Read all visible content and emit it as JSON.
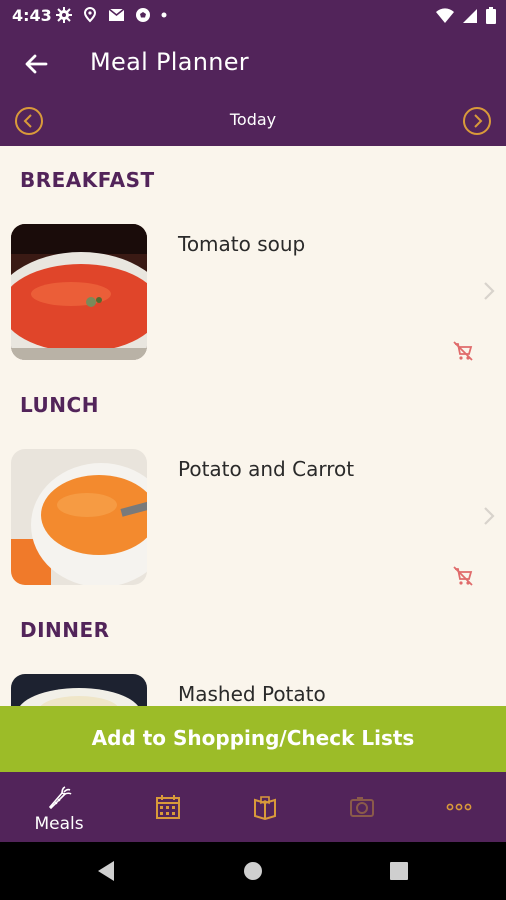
{
  "status_bar": {
    "time": "4:43"
  },
  "app_bar": {
    "title": "Meal Planner"
  },
  "date_bar": {
    "label": "Today"
  },
  "sections": [
    {
      "title": "BREAKFAST",
      "meal": "Tomato soup"
    },
    {
      "title": "LUNCH",
      "meal": "Potato and Carrot"
    },
    {
      "title": "DINNER",
      "meal": "Mashed Potato"
    }
  ],
  "action_button": {
    "label": "Add to Shopping/Check Lists"
  },
  "bottom_nav": [
    {
      "label": "Meals",
      "icon": "carrot-icon"
    },
    {
      "label": "",
      "icon": "calendar-icon"
    },
    {
      "label": "",
      "icon": "book-icon"
    },
    {
      "label": "",
      "icon": "camera-icon"
    },
    {
      "label": "",
      "icon": "more-icon"
    }
  ],
  "colors": {
    "primary": "#52245a",
    "accent": "#d99a3a",
    "action": "#9cbc28",
    "background": "#faf5ec",
    "cart_icon": "#e06b6b"
  }
}
